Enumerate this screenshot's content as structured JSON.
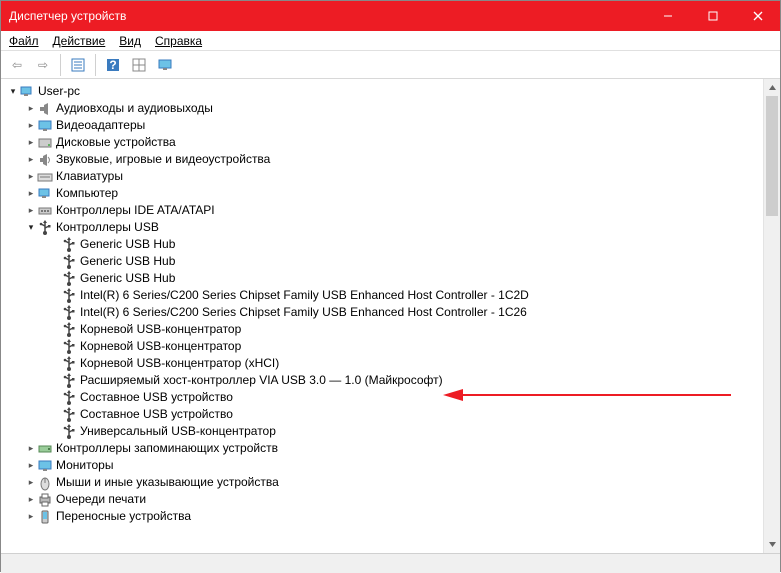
{
  "window": {
    "title": "Диспетчер устройств"
  },
  "menu": {
    "file": "Файл",
    "action": "Действие",
    "view": "Вид",
    "help": "Справка"
  },
  "tree": {
    "root": "User-pc",
    "items": [
      {
        "label": "Аудиовходы и аудиовыходы",
        "icon": "audio"
      },
      {
        "label": "Видеоадаптеры",
        "icon": "display"
      },
      {
        "label": "Дисковые устройства",
        "icon": "disk"
      },
      {
        "label": "Звуковые, игровые и видеоустройства",
        "icon": "sound"
      },
      {
        "label": "Клавиатуры",
        "icon": "keyboard"
      },
      {
        "label": "Компьютер",
        "icon": "computer"
      },
      {
        "label": "Контроллеры IDE ATA/ATAPI",
        "icon": "ide"
      },
      {
        "label": "Контроллеры USB",
        "icon": "usb",
        "expanded": true,
        "children": [
          {
            "label": "Generic USB Hub"
          },
          {
            "label": "Generic USB Hub"
          },
          {
            "label": "Generic USB Hub"
          },
          {
            "label": "Intel(R) 6 Series/C200 Series Chipset Family USB Enhanced Host Controller - 1C2D"
          },
          {
            "label": "Intel(R) 6 Series/C200 Series Chipset Family USB Enhanced Host Controller - 1C26"
          },
          {
            "label": "Корневой USB-концентратор"
          },
          {
            "label": "Корневой USB-концентратор"
          },
          {
            "label": "Корневой USB-концентратор (xHCI)"
          },
          {
            "label": "Расширяемый хост-контроллер VIA USB 3.0 — 1.0 (Майкрософт)",
            "highlight": true
          },
          {
            "label": "Составное USB устройство"
          },
          {
            "label": "Составное USB устройство"
          },
          {
            "label": "Универсальный USB-концентратор"
          }
        ]
      },
      {
        "label": "Контроллеры запоминающих устройств",
        "icon": "storage"
      },
      {
        "label": "Мониторы",
        "icon": "monitor"
      },
      {
        "label": "Мыши и иные указывающие устройства",
        "icon": "mouse"
      },
      {
        "label": "Очереди печати",
        "icon": "print"
      },
      {
        "label": "Переносные устройства",
        "icon": "portable"
      }
    ]
  }
}
